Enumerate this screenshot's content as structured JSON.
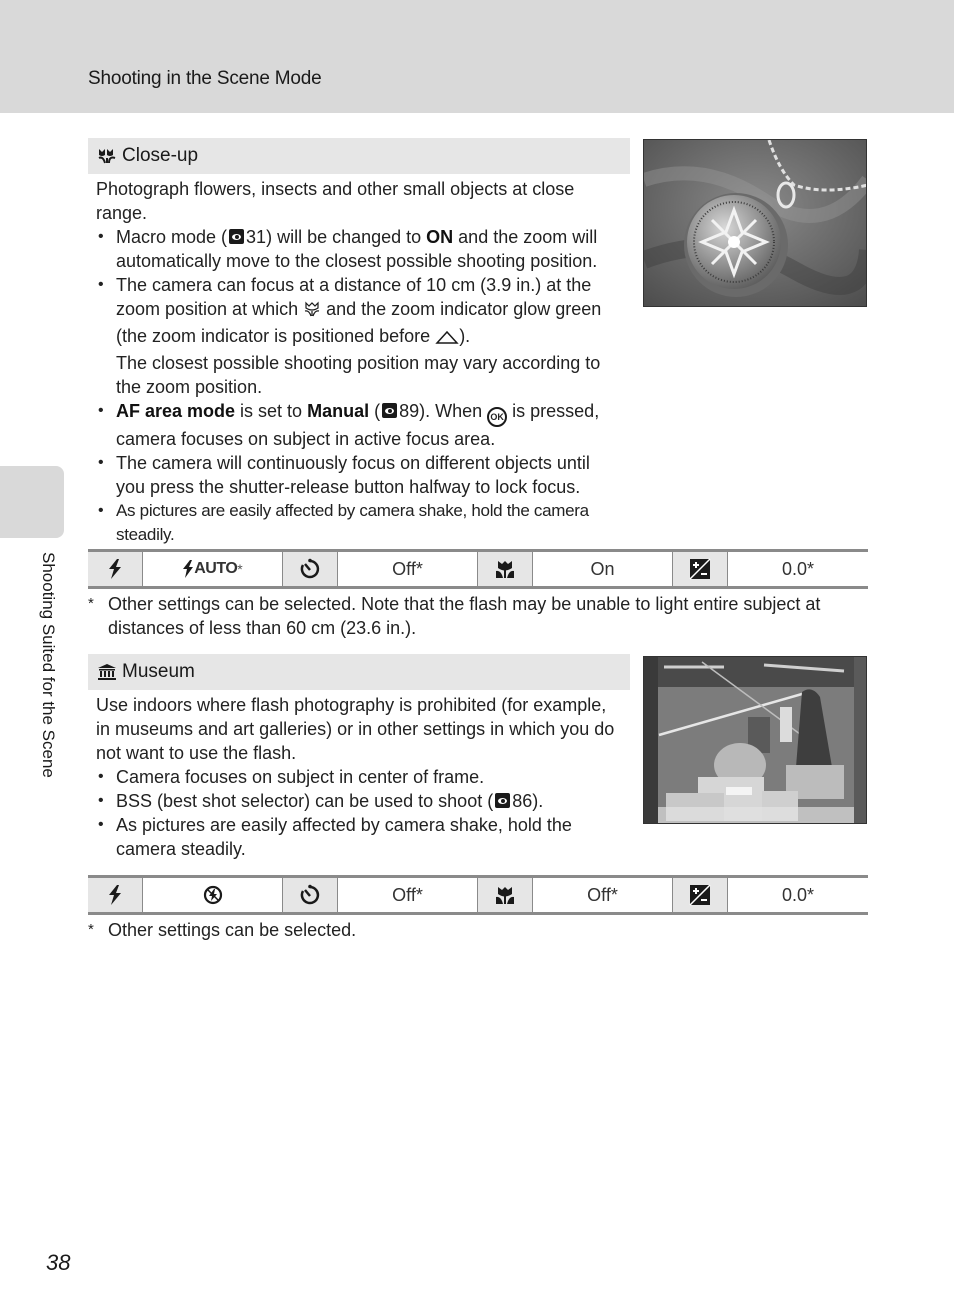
{
  "header": {
    "title": "Shooting in the Scene Mode"
  },
  "side_tab": {
    "label": "Shooting Suited for the Scene"
  },
  "page_number": "38",
  "closeup": {
    "icon": "close-up-scene-icon",
    "title": "Close-up",
    "intro": "Photograph flowers, insects and other small objects at close range.",
    "bullet1": {
      "pre": "Macro mode (",
      "ref": "31",
      "mid": ") will be changed to ",
      "bold": "ON",
      "post": " and the zoom will automatically move to the closest possible shooting position."
    },
    "bullet2": {
      "pre": "The camera can focus at a distance of 10 cm (3.9 in.) at the zoom position at which ",
      "mid": " and the zoom indicator glow green (the zoom indicator is positioned before ",
      "post": ").",
      "extra": "The closest possible shooting position may vary according to the zoom position."
    },
    "bullet3": {
      "bold1": "AF area mode",
      "t1": " is set to ",
      "bold2": "Manual",
      "t2": " (",
      "ref": "89",
      "t3": "). When ",
      "ok": "OK",
      "t4": " is pressed, camera focuses on subject in active focus area."
    },
    "bullet4": "The camera will continuously focus on different objects until you press the shutter-release button halfway to lock focus.",
    "bullet5": "As pictures are easily affected by camera shake, hold the camera steadily.",
    "photo_alt": "Close-up photo of an ornate silver pendant on a chain",
    "settings": {
      "flash_icon": "flash-icon",
      "flash_value": "AUTO",
      "flash_star": "*",
      "timer_icon": "self-timer-icon",
      "timer_value": "Off*",
      "macro_icon": "macro-icon",
      "macro_value": "On",
      "exposure_icon": "exposure-compensation-icon",
      "exposure_value": "0.0*"
    },
    "footnote_star": "*",
    "footnote": "Other settings can be selected. Note that the flash may be unable to light entire subject at distances of less than 60 cm (23.6 in.)."
  },
  "museum": {
    "icon": "museum-scene-icon",
    "title": "Museum",
    "intro": "Use indoors where flash photography is prohibited (for example, in museums and art galleries) or in other settings in which you do not want to use the flash.",
    "bullet1": "Camera focuses on subject in center of frame.",
    "bullet2": {
      "pre": "BSS (best shot selector) can be used to shoot (",
      "ref": "86",
      "post": ")."
    },
    "bullet3": "As pictures are easily affected by camera shake, hold the camera steadily.",
    "photo_alt": "Museum display case with sculptures and artifacts",
    "settings": {
      "flash_icon": "flash-icon",
      "flash_value_icon": "flash-off-icon",
      "timer_icon": "self-timer-icon",
      "timer_value": "Off*",
      "macro_icon": "macro-icon",
      "macro_value": "Off*",
      "exposure_icon": "exposure-compensation-icon",
      "exposure_value": "0.0*"
    },
    "footnote_star": "*",
    "footnote": "Other settings can be selected."
  }
}
